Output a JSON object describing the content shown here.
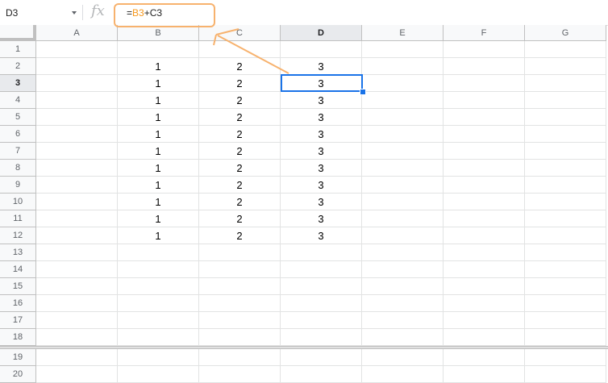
{
  "formula_bar": {
    "name_box": "D3",
    "fx_label": "fx",
    "formula_prefix": "=",
    "formula_ref1": "B3",
    "formula_op": "+",
    "formula_ref2": "C3"
  },
  "columns": [
    "A",
    "B",
    "C",
    "D",
    "E",
    "F",
    "G"
  ],
  "selected_column": "D",
  "rows": [
    "1",
    "2",
    "3",
    "4",
    "5",
    "6",
    "7",
    "8",
    "9",
    "10",
    "11",
    "12",
    "13",
    "14",
    "15",
    "16",
    "17",
    "18",
    "19",
    "20"
  ],
  "selected_row": "3",
  "cells": {
    "B": [
      "",
      "1",
      "1",
      "1",
      "1",
      "1",
      "1",
      "1",
      "1",
      "1",
      "1",
      "1"
    ],
    "C": [
      "",
      "2",
      "2",
      "2",
      "2",
      "2",
      "2",
      "2",
      "2",
      "2",
      "2",
      "2"
    ],
    "D": [
      "",
      "3",
      "3",
      "3",
      "3",
      "3",
      "3",
      "3",
      "3",
      "3",
      "3",
      "3"
    ]
  },
  "colors": {
    "annotation": "#f7b26e",
    "selection": "#1a73e8",
    "ref_highlight": "#f7981d"
  }
}
